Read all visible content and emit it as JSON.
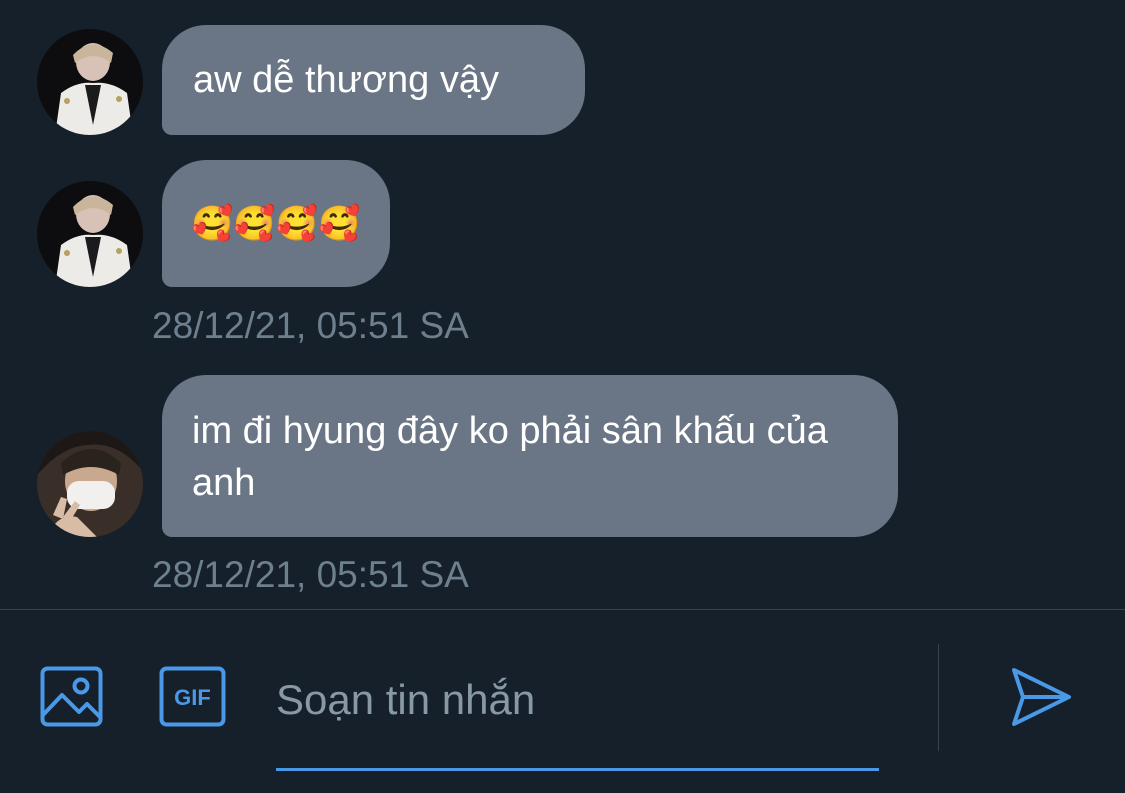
{
  "conversation": {
    "messages": [
      {
        "text": "aw dễ thương vậy"
      },
      {
        "text": "🥰🥰🥰🥰"
      },
      {
        "text": "im đi hyung đây ko phải sân khấu của anh"
      }
    ],
    "timestamps": [
      "28/12/21, 05:51 SA",
      "28/12/21, 05:51 SA"
    ]
  },
  "composer": {
    "placeholder": "Soạn tin nhắn",
    "value": "",
    "icons": [
      "image-icon",
      "gif-icon",
      "send-icon"
    ],
    "accent_color": "#4a99e9"
  },
  "colors": {
    "background": "#15202b",
    "bubble": "#6a7685",
    "timestamp": "#6e7f8e",
    "divider": "#38444d"
  }
}
